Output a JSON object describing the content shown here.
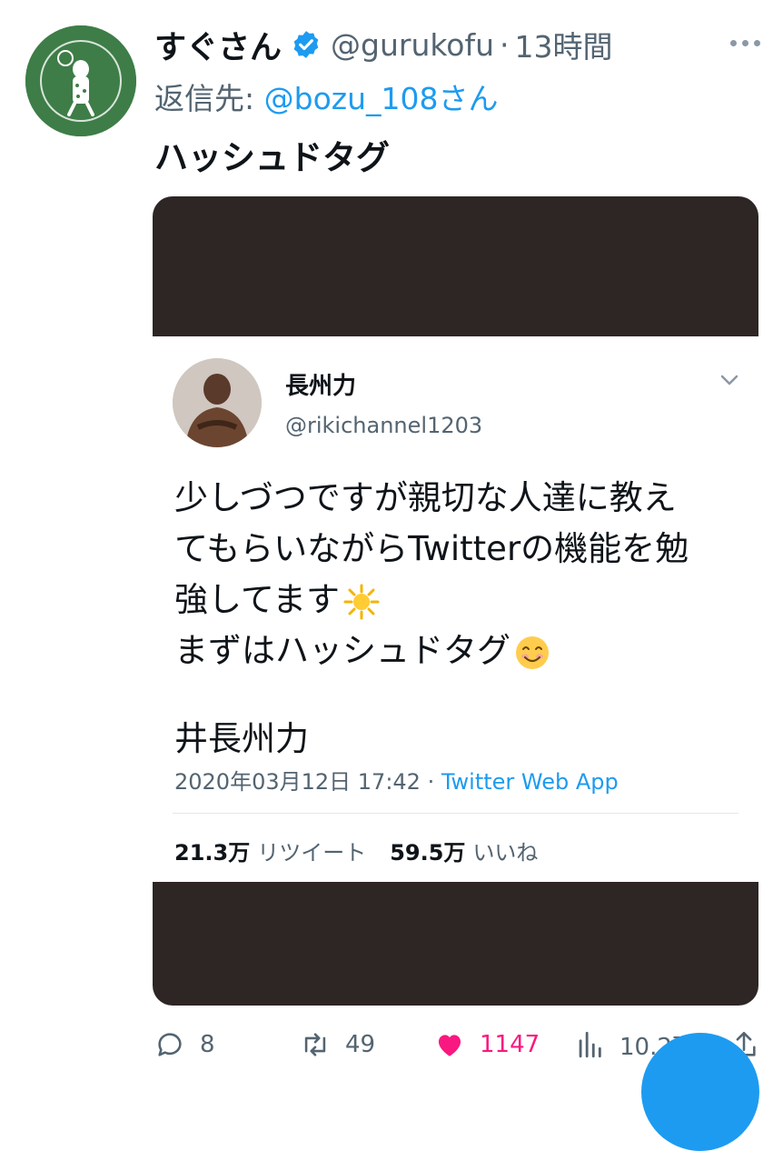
{
  "tweet": {
    "display_name": "すぐさん",
    "handle": "@gurukofu",
    "separator": "·",
    "time": "13時間",
    "reply_prefix": "返信先:",
    "reply_to": "@bozu_108さん",
    "text": "ハッシュドタグ"
  },
  "embedded": {
    "name": "長州力",
    "handle": "@rikichannel1203",
    "lines": [
      "少しづつですが親切な人達に教え",
      "てもらいながらTwitterの機能を勉",
      "強してます",
      "まずはハッシュドタグ"
    ],
    "hashtag": "井長州力",
    "date": "2020年03月12日 17:42 · ",
    "app": "Twitter Web App",
    "retweets": "21.3万",
    "retweets_label": "リツイート",
    "likes": "59.5万",
    "likes_label": "いいね"
  },
  "actions": {
    "replies": "8",
    "retweets": "49",
    "likes": "1147",
    "views": "10.2万"
  },
  "colors": {
    "accent": "#1d9bf0",
    "like": "#f91880",
    "media_bg": "#2e2525",
    "avatar_bg": "#3e7d47"
  },
  "icons": {
    "verified": "verified-badge-icon",
    "more": "more-dots-icon",
    "reply": "comment-icon",
    "retweet": "retweet-icon",
    "like": "heart-icon",
    "views": "bar-chart-icon",
    "share": "share-icon"
  }
}
